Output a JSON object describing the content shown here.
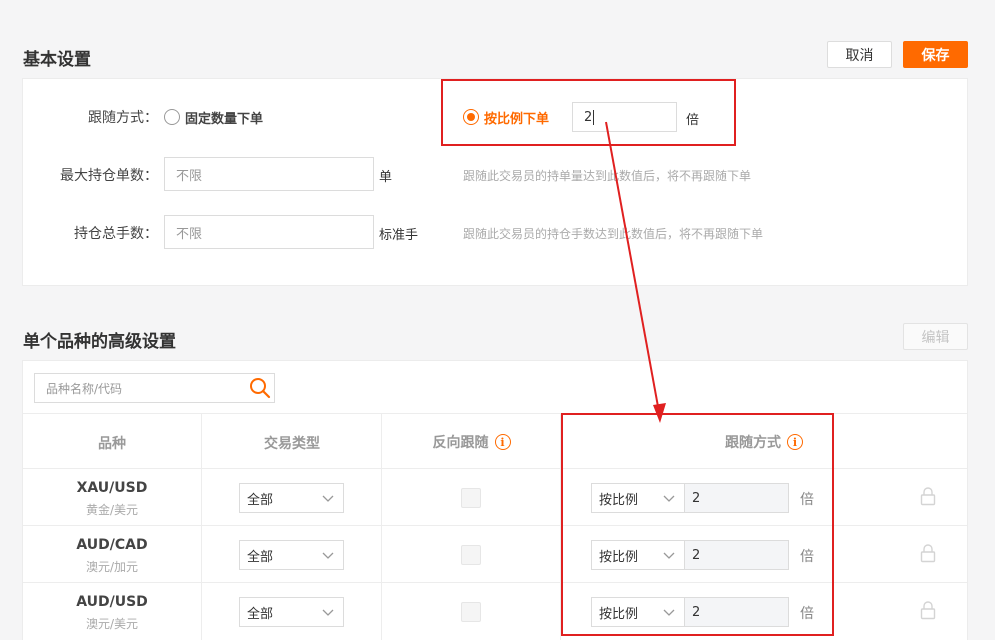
{
  "basic": {
    "title": "基本设置",
    "cancel_label": "取消",
    "save_label": "保存",
    "follow_mode": {
      "label": "跟随方式：",
      "option_fixed": "固定数量下单",
      "option_ratio": "按比例下单",
      "ratio_value": "2",
      "ratio_unit": "倍"
    },
    "max_positions": {
      "label": "最大持仓单数：",
      "value": "不限",
      "unit": "单",
      "hint": "跟随此交易员的持单量达到此数值后，将不再跟随下单"
    },
    "total_lots": {
      "label": "持仓总手数：",
      "value": "不限",
      "unit": "标准手",
      "hint": "跟随此交易员的持仓手数达到此数值后，将不再跟随下单"
    }
  },
  "advanced": {
    "title": "单个品种的高级设置",
    "edit_label": "编辑",
    "search_placeholder": "品种名称/代码",
    "columns": {
      "symbol": "品种",
      "trade_type": "交易类型",
      "reverse": "反向跟随",
      "follow_mode": "跟随方式"
    },
    "rows": [
      {
        "symbol": "XAU/USD",
        "name": "黄金/美元",
        "trade_type": "全部",
        "mode": "按比例",
        "value": "2",
        "unit": "倍"
      },
      {
        "symbol": "AUD/CAD",
        "name": "澳元/加元",
        "trade_type": "全部",
        "mode": "按比例",
        "value": "2",
        "unit": "倍"
      },
      {
        "symbol": "AUD/USD",
        "name": "澳元/美元",
        "trade_type": "全部",
        "mode": "按比例",
        "value": "2",
        "unit": "倍"
      }
    ]
  },
  "icons": {
    "info": "info-icon",
    "search": "search-icon",
    "chevron": "chevron-down-icon",
    "lock": "lock-icon",
    "arrow": "annotation-arrow"
  },
  "colors": {
    "accent": "#ff6a00",
    "annotation": "#e02020"
  }
}
